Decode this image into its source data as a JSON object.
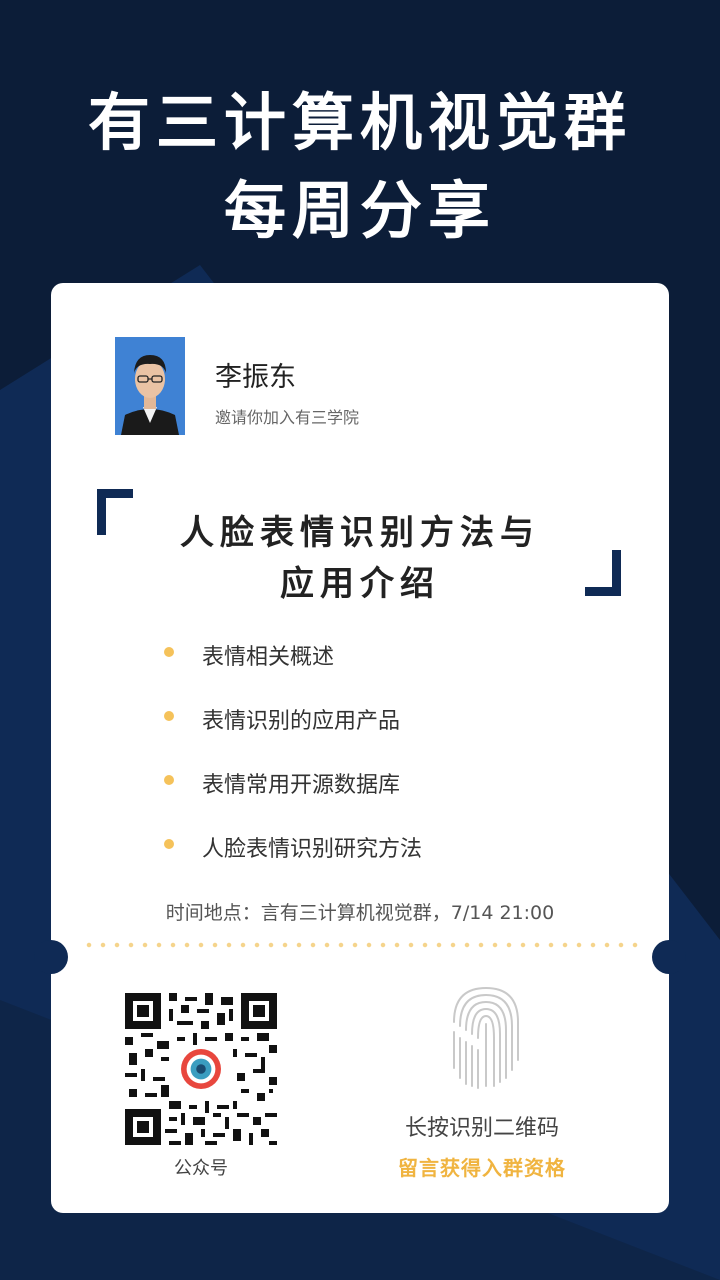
{
  "header": {
    "title_line1": "有三计算机视觉群",
    "title_line2": "每周分享"
  },
  "inviter": {
    "name": "李振东",
    "invite_text": "邀请你加入有三学院"
  },
  "talk": {
    "title_line1": "人脸表情识别方法与",
    "title_line2": "应用介绍",
    "topics": [
      "表情相关概述",
      "表情识别的应用产品",
      "表情常用开源数据库",
      "人脸表情识别研究方法"
    ],
    "time_place": "时间地点：言有三计算机视觉群，7/14 21:00"
  },
  "footer": {
    "qr_caption": "公众号",
    "scan_text": "长按识别二维码",
    "join_text": "留言获得入群资格"
  },
  "colors": {
    "background": "#0c1d38",
    "accent_navy": "#0f2a55",
    "accent_yellow": "#f5c25a",
    "join_text": "#f0b440"
  }
}
